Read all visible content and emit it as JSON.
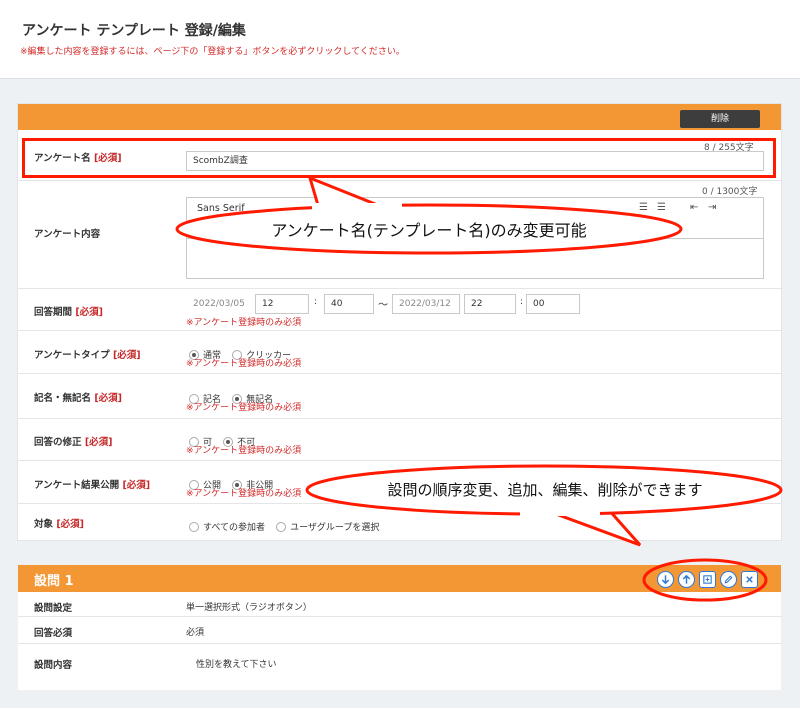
{
  "header": {
    "title": "アンケート テンプレート 登録/編集",
    "notice": "※編集した内容を登録するには、ページ下の「登録する」ボタンを必ずクリックしてください。"
  },
  "toolbar": {
    "delete_label": "削除"
  },
  "form": {
    "required_tag": "[必須]",
    "name": {
      "label": "アンケート名",
      "value": "ScombZ調査",
      "count": "8 / 255文字"
    },
    "content": {
      "label": "アンケート内容",
      "count": "0 / 1300文字",
      "editor_font": "Sans Serif"
    },
    "period": {
      "label": "回答期間",
      "start_date": "2022/03/05",
      "start_hour": "12",
      "start_min": "40",
      "separator": "〜",
      "end_date": "2022/03/12",
      "end_hour": "22",
      "end_min": "00",
      "colon": ":",
      "note": "※アンケート登録時のみ必須"
    },
    "type": {
      "label": "アンケートタイプ",
      "options": [
        "通常",
        "クリッカー"
      ],
      "note": "※アンケート登録時のみ必須"
    },
    "anonymity": {
      "label": "記名・無記名",
      "options": [
        "記名",
        "無記名"
      ],
      "note": "※アンケート登録時のみ必須"
    },
    "edit_answer": {
      "label": "回答の修正",
      "options": [
        "可",
        "不可"
      ],
      "note": "※アンケート登録時のみ必須"
    },
    "result_public": {
      "label": "アンケート結果公開",
      "options": [
        "公開",
        "非公開"
      ],
      "note": "※アンケート登録時のみ必須"
    },
    "target": {
      "label": "対象",
      "options": [
        "すべての参加者",
        "ユーザグループを選択"
      ]
    }
  },
  "question": {
    "title": "設問 1",
    "setting_label": "設問設定",
    "setting_value": "単一選択形式（ラジオボタン）",
    "required_label": "回答必須",
    "required_value": "必須",
    "content_label": "設問内容",
    "content_value": "性別を教えて下さい",
    "actions": [
      "arrow-down-icon",
      "arrow-up-icon",
      "copy-add-icon",
      "pencil-icon",
      "close-icon"
    ]
  },
  "annotations": {
    "callout1": "アンケート名(テンプレート名)のみ変更可能",
    "callout2": "設問の順序変更、追加、編集、削除ができます"
  },
  "colors": {
    "accent": "#f29733",
    "highlight": "#ff1a00",
    "required": "#c62828",
    "icon_blue": "#2f79d4"
  }
}
